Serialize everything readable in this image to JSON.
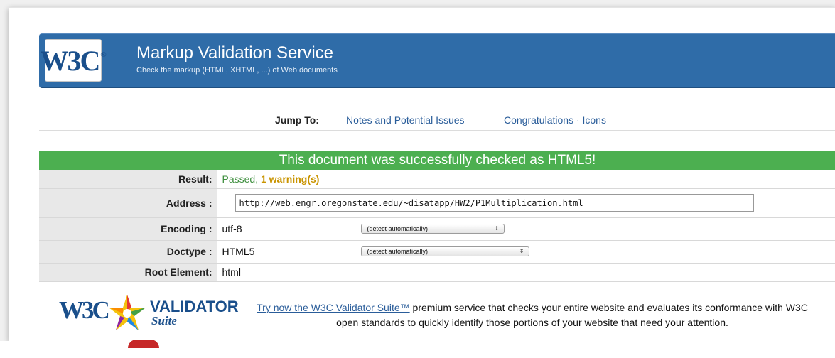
{
  "header": {
    "logo_text": "W3C",
    "logo_mark": "®",
    "title": "Markup Validation Service",
    "subtitle": "Check the markup (HTML, XHTML, ...) of Web documents"
  },
  "jump": {
    "label": "Jump To:",
    "links": [
      "Notes and Potential Issues",
      "Congratulations · Icons"
    ]
  },
  "result_banner": "This document was successfully checked as HTML5!",
  "results": {
    "result_label": "Result:",
    "result_passed": "Passed, ",
    "result_warnings": "1 warning(s)",
    "address_label": "Address :",
    "address_value": "http://web.engr.oregonstate.edu/~disatapp/HW2/P1Multiplication.html",
    "encoding_label": "Encoding :",
    "encoding_value": "utf-8",
    "encoding_select": "(detect automatically)",
    "doctype_label": "Doctype :",
    "doctype_value": "HTML5",
    "doctype_select": "(detect automatically)",
    "root_label": "Root Element:",
    "root_value": "html"
  },
  "suite": {
    "logo_w3c": "W3C",
    "logo_validator": "VALIDATOR",
    "logo_suite": "Suite",
    "promo_link": "Try now the W3C Validator Suite™",
    "promo_text": " premium service that checks your entire website and evaluates its conformance with W3C open standards to quickly identify those portions of your website that need your attention."
  },
  "colors": {
    "banner_blue": "#2f6ca8",
    "success_green": "#4caf50",
    "warning_amber": "#c99400",
    "link_blue": "#2a5d9a"
  },
  "icons": [
    "w3c-logo-icon",
    "validator-suite-star-icon",
    "select-arrows-icon"
  ]
}
